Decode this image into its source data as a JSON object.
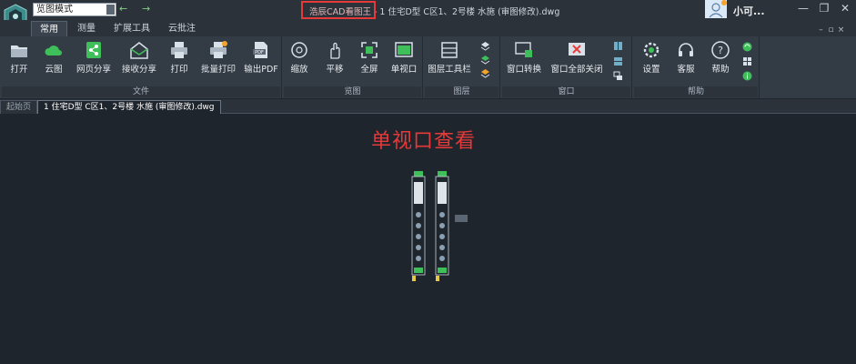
{
  "titlebar": {
    "mode_select": "览图模式",
    "title_brand": "浩辰CAD看图王",
    "title_rest": " - 1 住宅D型  C区1、2号楼 水施 (审图修改).dwg",
    "user_name": "小可..."
  },
  "ribbon_tabs": [
    "常用",
    "测量",
    "扩展工具",
    "云批注"
  ],
  "groups": {
    "file": "文件",
    "view": "览图",
    "layer": "图层",
    "window": "窗口",
    "help": "帮助"
  },
  "buttons": {
    "open": "打开",
    "cloud": "云图",
    "web_share": "网页分享",
    "receive_share": "接收分享",
    "print": "打印",
    "batch_print": "批量打印",
    "export_pdf": "输出PDF",
    "zoom": "缩放",
    "pan": "平移",
    "fullscreen": "全屏",
    "single_viewport": "单视口",
    "layer_toolbar": "图层工具栏",
    "window_switch": "窗口转换",
    "close_all_windows": "窗口全部关闭",
    "settings": "设置",
    "support": "客服",
    "help": "帮助"
  },
  "doc_tabs": {
    "home": "起始页",
    "active": "1 住宅D型  C区1、2号楼 水施 (审图修改).dwg"
  },
  "canvas": {
    "caption": "单视口查看"
  },
  "colors": {
    "accent_red": "#e53a3a",
    "icon_green": "#3fbf5a",
    "background": "#1f252c"
  }
}
